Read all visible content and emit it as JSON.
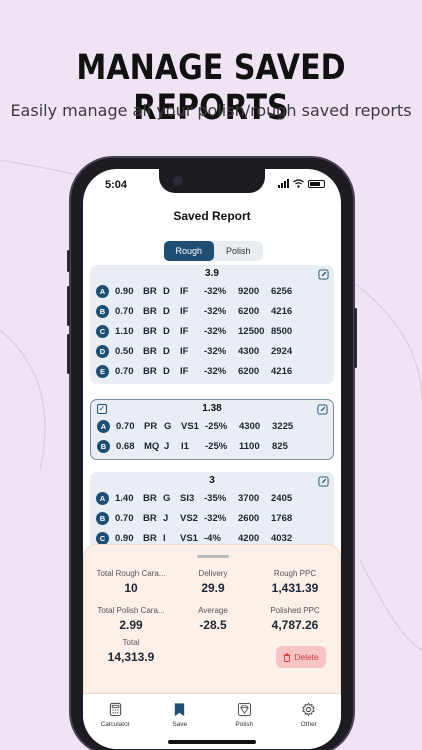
{
  "header": {
    "headline": "MANAGE SAVED REPORTS",
    "subline": "Easily manage all your polish/rough saved reports"
  },
  "status_bar": {
    "time": "5:04"
  },
  "screen": {
    "title": "Saved Report",
    "segments": [
      "Rough",
      "Polish"
    ],
    "active_segment": "Rough"
  },
  "reports": [
    {
      "title": "3.9",
      "selected": false,
      "rows": [
        [
          "A",
          "0.90",
          "BR",
          "D",
          "IF",
          "-32%",
          "9200",
          "6256"
        ],
        [
          "B",
          "0.70",
          "BR",
          "D",
          "IF",
          "-32%",
          "6200",
          "4216"
        ],
        [
          "C",
          "1.10",
          "BR",
          "D",
          "IF",
          "-32%",
          "12500",
          "8500"
        ],
        [
          "D",
          "0.50",
          "BR",
          "D",
          "IF",
          "-32%",
          "4300",
          "2924"
        ],
        [
          "E",
          "0.70",
          "BR",
          "D",
          "IF",
          "-32%",
          "6200",
          "4216"
        ]
      ]
    },
    {
      "title": "1.38",
      "selected": true,
      "rows": [
        [
          "A",
          "0.70",
          "PR",
          "G",
          "VS1",
          "-25%",
          "4300",
          "3225"
        ],
        [
          "B",
          "0.68",
          "MQ",
          "J",
          "I1",
          "-25%",
          "1100",
          "825"
        ]
      ]
    },
    {
      "title": "3",
      "selected": false,
      "rows": [
        [
          "A",
          "1.40",
          "BR",
          "G",
          "SI3",
          "-35%",
          "3700",
          "2405"
        ],
        [
          "B",
          "0.70",
          "BR",
          "J",
          "VS2",
          "-32%",
          "2600",
          "1768"
        ],
        [
          "C",
          "0.90",
          "BR",
          "I",
          "VS1",
          "-4%",
          "4200",
          "4032"
        ]
      ]
    }
  ],
  "summary": {
    "total_rough_label": "Total Rough Cara...",
    "total_rough_value": "10",
    "delivery_label": "Delivery",
    "delivery_value": "29.9",
    "rough_ppc_label": "Rough PPC",
    "rough_ppc_value": "1,431.39",
    "total_polish_label": "Total Polish Cara...",
    "total_polish_value": "2.99",
    "average_label": "Average",
    "average_value": "-28.5",
    "polished_ppc_label": "Polished PPC",
    "polished_ppc_value": "4,787.26",
    "total_label": "Total",
    "total_value": "14,313.9",
    "delete_label": "Delete"
  },
  "tabbar": {
    "items": [
      {
        "label": "Calculator",
        "icon": "calculator-icon"
      },
      {
        "label": "Save",
        "icon": "bookmark-icon",
        "active": true
      },
      {
        "label": "Polish",
        "icon": "diamond-icon"
      },
      {
        "label": "Other",
        "icon": "gear-icon"
      }
    ]
  },
  "colors": {
    "accent": "#1e4e73",
    "background": "#efe3f4",
    "card": "#e8eef3",
    "summary": "#fdf0e8",
    "delete_bg": "#f8c3c3",
    "delete_text": "#d43c3c"
  }
}
